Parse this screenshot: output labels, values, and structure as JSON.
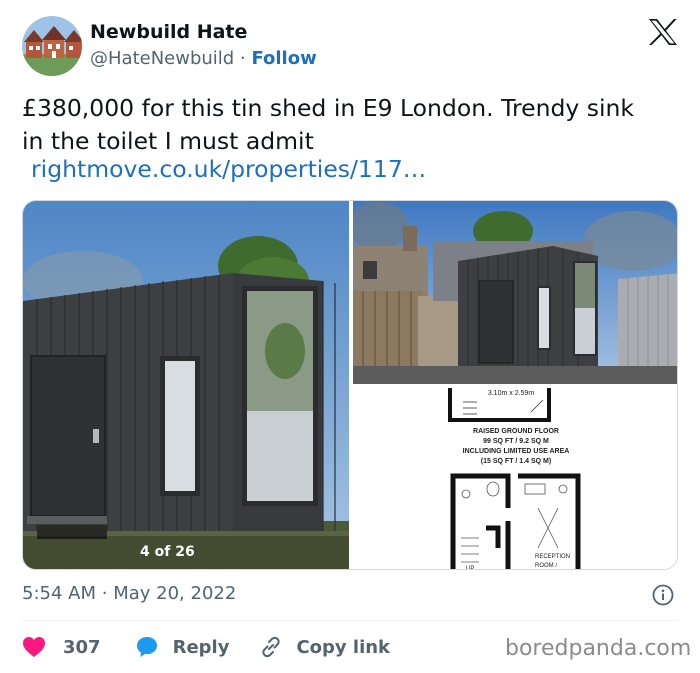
{
  "author": {
    "name": "Newbuild Hate",
    "handle": "@HateNewbuild",
    "separator": "·",
    "follow_label": "Follow",
    "avatar_icon": "house-row-avatar"
  },
  "platform_icon": "x-logo-icon",
  "tweet": {
    "text": "£380,000 for this tin shed in E9 London. Trendy sink in the toilet I must admit",
    "link": "rightmove.co.uk/properties/117…"
  },
  "media": {
    "counter": "4 of 26",
    "floorplan": {
      "dimensions": "3.10m x 2.59m",
      "title_lines": [
        "RAISED GROUND FLOOR",
        "99 SQ FT / 9.2 SQ M",
        "INCLUDING LIMITED USE AREA",
        "(15 SQ FT / 1.4 SQ M)"
      ],
      "up_label": "UP",
      "reception_label": "RECEPTION",
      "room_label": "ROOM /"
    }
  },
  "timestamp": {
    "time": "5:54 AM",
    "separator": "·",
    "date": "May 20, 2022"
  },
  "actions": {
    "like_count": "307",
    "reply_label": "Reply",
    "copy_link_label": "Copy link"
  },
  "watermark": "boredpanda.com",
  "colors": {
    "link": "#1d6fc2",
    "like": "#f91880",
    "reply": "#1d9bf0",
    "muted": "#536471"
  }
}
